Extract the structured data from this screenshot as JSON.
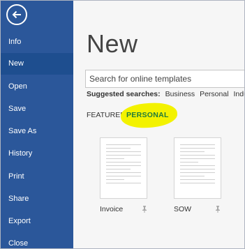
{
  "sidebar": {
    "back_icon": "back-arrow-icon",
    "items": [
      {
        "label": "Info"
      },
      {
        "label": "New",
        "active": true
      },
      {
        "label": "Open"
      },
      {
        "label": "Save"
      },
      {
        "label": "Save As"
      },
      {
        "label": "History"
      },
      {
        "label": "Print"
      },
      {
        "label": "Share"
      },
      {
        "label": "Export"
      },
      {
        "label": "Close"
      }
    ]
  },
  "main": {
    "title": "New",
    "search": {
      "placeholder": "Search for online templates"
    },
    "suggested": {
      "label": "Suggested searches:",
      "items": [
        "Business",
        "Personal",
        "Indus"
      ]
    },
    "tabs": [
      {
        "label": "FEATURED"
      },
      {
        "label": "PERSONAL",
        "active": true
      }
    ],
    "templates": [
      {
        "name": "Invoice",
        "pin_icon": "pin-icon"
      },
      {
        "name": "SOW",
        "pin_icon": "pin-icon"
      }
    ]
  },
  "colors": {
    "sidebar_background": "#2b579a",
    "sidebar_active": "#1e4e8f",
    "main_background": "#f6f6f6",
    "highlight": "#f3f200",
    "personal_tab_text": "#1f7a3a"
  }
}
